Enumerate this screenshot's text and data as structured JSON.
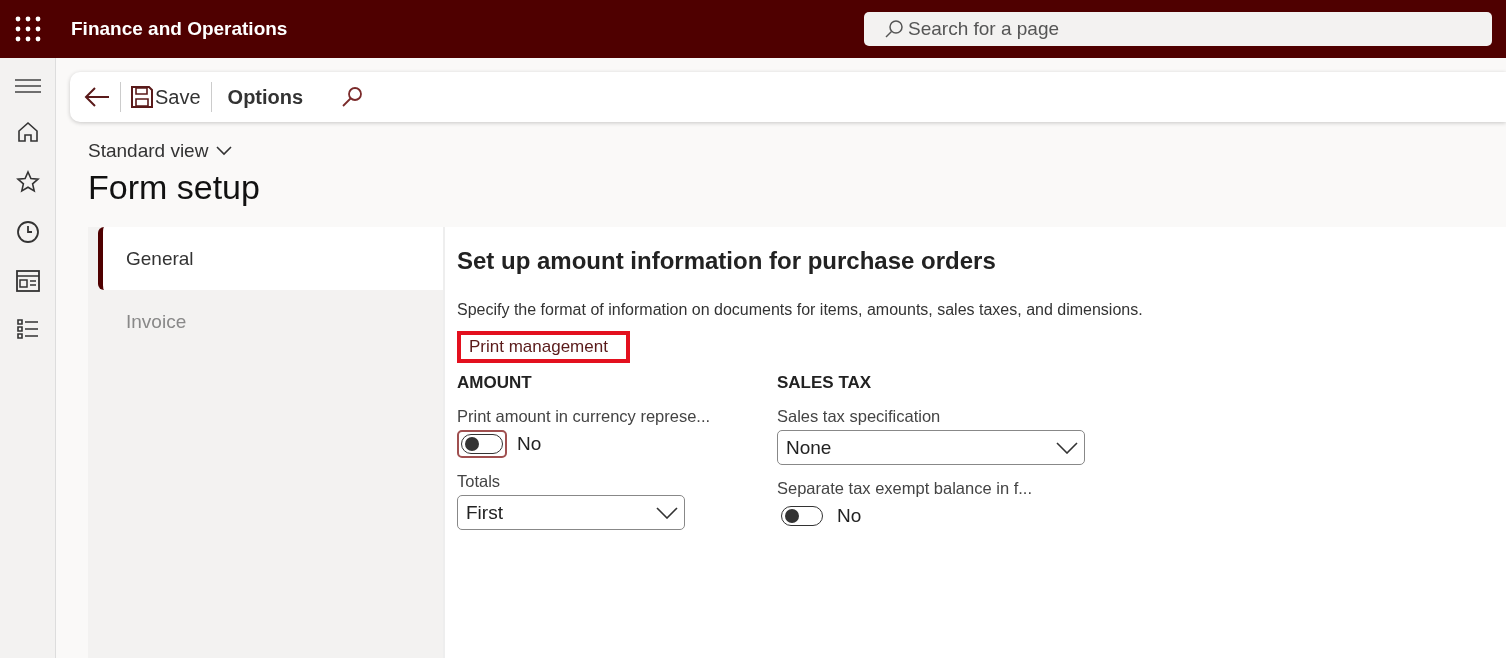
{
  "app": {
    "title": "Finance and Operations"
  },
  "search": {
    "placeholder": "Search for a page"
  },
  "toolbar": {
    "save": "Save",
    "options": "Options"
  },
  "view": {
    "label": "Standard view"
  },
  "page_title": "Form setup",
  "tabs": [
    {
      "label": "General",
      "selected": true
    },
    {
      "label": "Invoice",
      "selected": false
    }
  ],
  "section": {
    "title": "Set up amount information for purchase orders",
    "description": "Specify the format of information on documents for items, amounts, sales taxes, and dimensions.",
    "link": {
      "label": "Print management",
      "highlighted": true
    }
  },
  "groups": [
    {
      "title": "AMOUNT",
      "fields": [
        {
          "kind": "toggle",
          "label": "Print amount in currency represe...",
          "on": false,
          "focused": true,
          "value": "No"
        },
        {
          "kind": "dropdown",
          "label": "Totals",
          "value": "First"
        }
      ]
    },
    {
      "title": "SALES TAX",
      "fields": [
        {
          "kind": "dropdown",
          "label": "Sales tax specification",
          "value": "None"
        },
        {
          "kind": "toggle",
          "label": "Separate tax exempt balance in f...",
          "on": false,
          "focused": false,
          "value": "No"
        }
      ]
    }
  ]
}
